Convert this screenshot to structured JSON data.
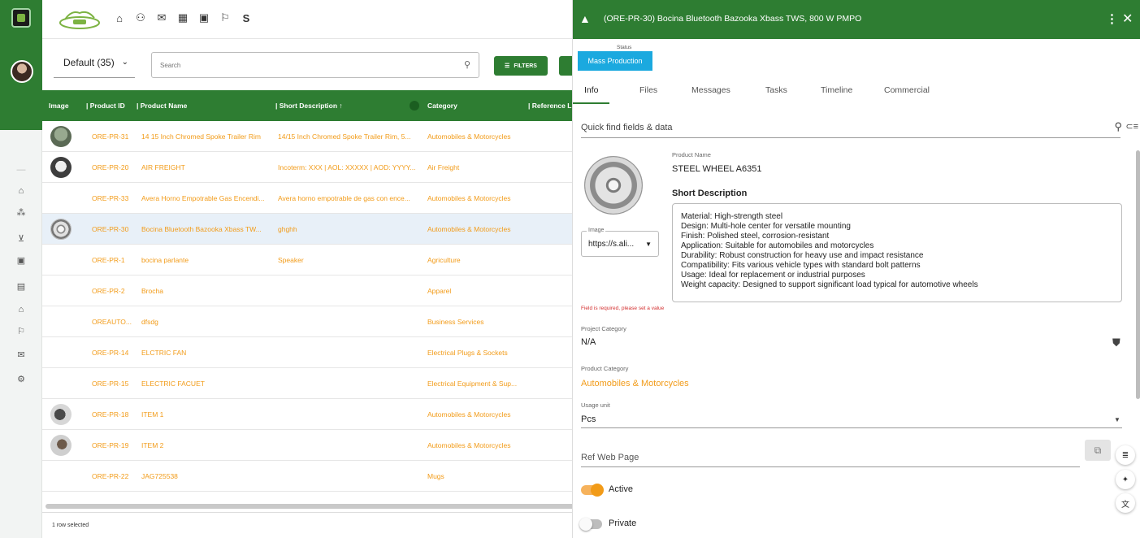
{
  "app": {
    "top_icons": [
      "home-icon",
      "users-icon",
      "mail-icon",
      "building-icon",
      "contact-card-icon",
      "flag-icon"
    ],
    "top_letter": "S",
    "rail_icons": [
      "home-icon",
      "network-icon",
      "cart-icon",
      "document-search-icon",
      "clipboard-icon",
      "factory-icon",
      "flag-icon",
      "mail-icon",
      "settings-icon"
    ]
  },
  "list": {
    "view_label": "Default (35)",
    "search_placeholder": "Search",
    "filters_label": "FILTERS",
    "columns": {
      "image": "Image",
      "product_id": "| Product ID",
      "product_name": "| Product Name",
      "short_description": "| Short Description ↑",
      "category": "Category",
      "reference": "| Reference L"
    },
    "rows": [
      {
        "id": "ORE-PR-31",
        "name": "14 15 Inch Chromed Spoke Trailer Rim",
        "desc": "14/15 Inch Chromed Spoke Trailer Rim, 5...",
        "category": "Automobiles & Motorcycles",
        "thumb": "t1"
      },
      {
        "id": "ORE-PR-20",
        "name": "AIR FREIGHT",
        "desc": "Incoterm: XXX | AOL: XXXXX | AOD: YYYY...",
        "category": "Air Freight",
        "thumb": "t2"
      },
      {
        "id": "ORE-PR-33",
        "name": "Avera Horno Empotrable Gas Encendi...",
        "desc": "Avera horno empotrable de gas con ence...",
        "category": "Automobiles & Motorcycles",
        "thumb": ""
      },
      {
        "id": "ORE-PR-30",
        "name": "Bocina Bluetooth Bazooka Xbass TW...",
        "desc": "ghghh",
        "category": "Automobiles & Motorcycles",
        "thumb": "t3"
      },
      {
        "id": "ORE-PR-1",
        "name": "bocina parlante",
        "desc": "Speaker",
        "category": "Agriculture",
        "thumb": ""
      },
      {
        "id": "ORE-PR-2",
        "name": "Brocha",
        "desc": "",
        "category": "Apparel",
        "thumb": ""
      },
      {
        "id": "OREAUTO...",
        "name": "dfsdg",
        "desc": "",
        "category": "Business Services",
        "thumb": ""
      },
      {
        "id": "ORE-PR-14",
        "name": "ELCTRIC FAN",
        "desc": "",
        "category": "Electrical Plugs & Sockets",
        "thumb": ""
      },
      {
        "id": "ORE-PR-15",
        "name": "ELECTRIC FACUET",
        "desc": "",
        "category": "Electrical Equipment & Sup...",
        "thumb": ""
      },
      {
        "id": "ORE-PR-18",
        "name": "ITEM 1",
        "desc": "",
        "category": "Automobiles & Motorcycles",
        "thumb": "t4"
      },
      {
        "id": "ORE-PR-19",
        "name": "ITEM 2",
        "desc": "",
        "category": "Automobiles & Motorcycles",
        "thumb": "t5"
      },
      {
        "id": "ORE-PR-22",
        "name": "JAG725538",
        "desc": "",
        "category": "Mugs",
        "thumb": ""
      }
    ],
    "footer": "1 row selected"
  },
  "panel": {
    "title": "(ORE-PR-30) Bocina Bluetooth Bazooka Xbass TWS, 800 W PMPO",
    "status_label": "Status",
    "status_value": "Mass Production",
    "tabs": [
      "Info",
      "Files",
      "Messages",
      "Tasks",
      "Timeline",
      "Commercial"
    ],
    "quick_find": "Quick find fields & data",
    "image_label": "Image",
    "image_value": "https://s.ali...",
    "product_name_label": "Product Name",
    "product_name_value": "STEEL WHEEL A6351",
    "short_desc_label": "Short Description",
    "short_desc_lines": [
      "Material: High-strength steel",
      "Design: Multi-hole center for versatile mounting",
      "Finish: Polished steel, corrosion-resistant",
      "Application: Suitable for automobiles and motorcycles",
      "Durability: Robust construction for heavy use and impact resistance",
      "Compatibility: Fits various vehicle types with standard bolt patterns",
      "Usage: Ideal for replacement or industrial purposes",
      "Weight capacity: Designed to support significant load typical for automotive wheels"
    ],
    "error_text": "Field is required, please set a value",
    "project_category_label": "Project Category",
    "project_category_value": "N/A",
    "product_category_label": "Product Category",
    "product_category_value": "Automobiles & Motorcycles",
    "usage_unit_label": "Usage unit",
    "usage_unit_value": "Pcs",
    "ref_web_label": "Ref Web Page",
    "active_label": "Active",
    "private_label": "Private"
  },
  "colors": {
    "brand_green": "#2e7d32",
    "accent_orange": "#f29b18",
    "status_blue": "#1ba9df",
    "error_red": "#d32f2f"
  }
}
